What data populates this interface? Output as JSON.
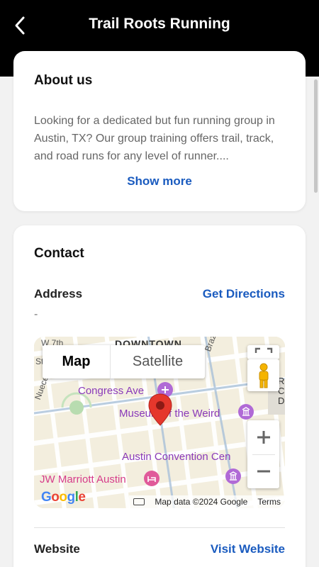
{
  "header": {
    "title": "Trail Roots Running",
    "back_icon": "chevron-left-icon"
  },
  "about": {
    "title": "About us",
    "text": "Looking for a dedicated but fun running group in Austin, TX? Our group training offers trail, track, and road runs for any level of runner....",
    "show_more_label": "Show more"
  },
  "contact": {
    "title": "Contact",
    "address_label": "Address",
    "directions_label": "Get Directions",
    "address_value": "-",
    "website_label": "Website",
    "website_link": "Visit Website"
  },
  "map": {
    "type_map": "Map",
    "type_satellite": "Satellite",
    "labels": {
      "downtown": "DOWNTOWN",
      "congress": "Congress Ave",
      "museum": "Museum of the Weird",
      "convention": "Austin Convention Cen",
      "jw": "JW Marriott Austin",
      "w7th": "W 7th",
      "st": "St",
      "brazos": "Brazos St",
      "nueces": "Nueces St",
      "rcd": "R\nC\nD"
    },
    "google_logo": "Google",
    "attribution": "Map data ©2024 Google",
    "terms": "Terms",
    "colors": {
      "purple": "#8a3ab9",
      "pink": "#d63c8a",
      "pin": "#e5372c"
    }
  },
  "colors": {
    "link": "#1a5bbf",
    "header_bg": "#000000"
  }
}
